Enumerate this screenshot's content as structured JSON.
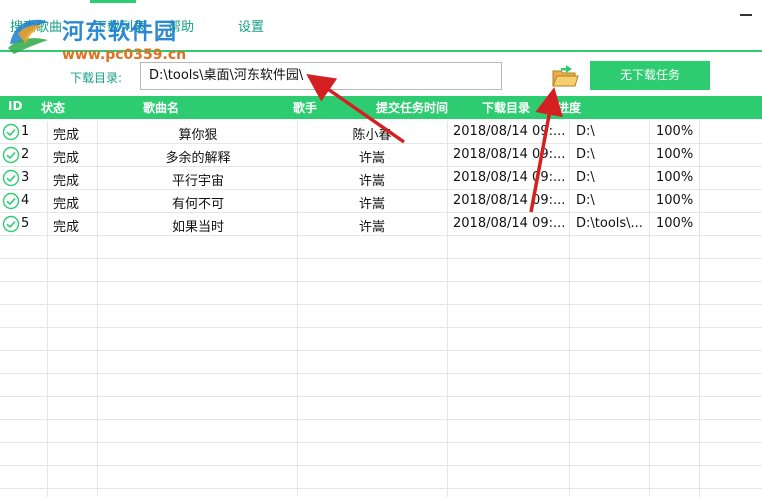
{
  "nav": {
    "tabs": [
      {
        "label": "搜索歌曲"
      },
      {
        "label": "下载列表"
      },
      {
        "label": "帮助"
      },
      {
        "label": "设置"
      }
    ],
    "accent": "#2ecc71"
  },
  "watermark": {
    "title": "河东软件园",
    "url": "www.pc0359.cn"
  },
  "download": {
    "label": "下载目录:",
    "path": "D:\\tools\\桌面\\河东软件园\\",
    "no_task_button": "无下载任务",
    "folder_icon": "folder-open-icon"
  },
  "table": {
    "columns": [
      "ID",
      "状态",
      "歌曲名",
      "歌手",
      "提交任务时间",
      "下载目录",
      "进度"
    ],
    "rows": [
      {
        "id": "1",
        "status": "完成",
        "song": "算你狠",
        "singer": "陈小春",
        "time": "2018/08/14 09:...",
        "dir": "D:\\",
        "progress": "100%"
      },
      {
        "id": "2",
        "status": "完成",
        "song": "多余的解释",
        "singer": "许嵩",
        "time": "2018/08/14 09:...",
        "dir": "D:\\",
        "progress": "100%"
      },
      {
        "id": "3",
        "status": "完成",
        "song": "平行宇宙",
        "singer": "许嵩",
        "time": "2018/08/14 09:...",
        "dir": "D:\\",
        "progress": "100%"
      },
      {
        "id": "4",
        "status": "完成",
        "song": "有何不可",
        "singer": "许嵩",
        "time": "2018/08/14 09:...",
        "dir": "D:\\",
        "progress": "100%"
      },
      {
        "id": "5",
        "status": "完成",
        "song": "如果当时",
        "singer": "许嵩",
        "time": "2018/08/14 09:...",
        "dir": "D:\\tools\\...",
        "progress": "100%"
      }
    ],
    "status_icon": "check-circle-icon"
  },
  "colors": {
    "accent": "#2ecc71",
    "label_text": "#16a085",
    "annotation_arrow": "#d42020"
  }
}
